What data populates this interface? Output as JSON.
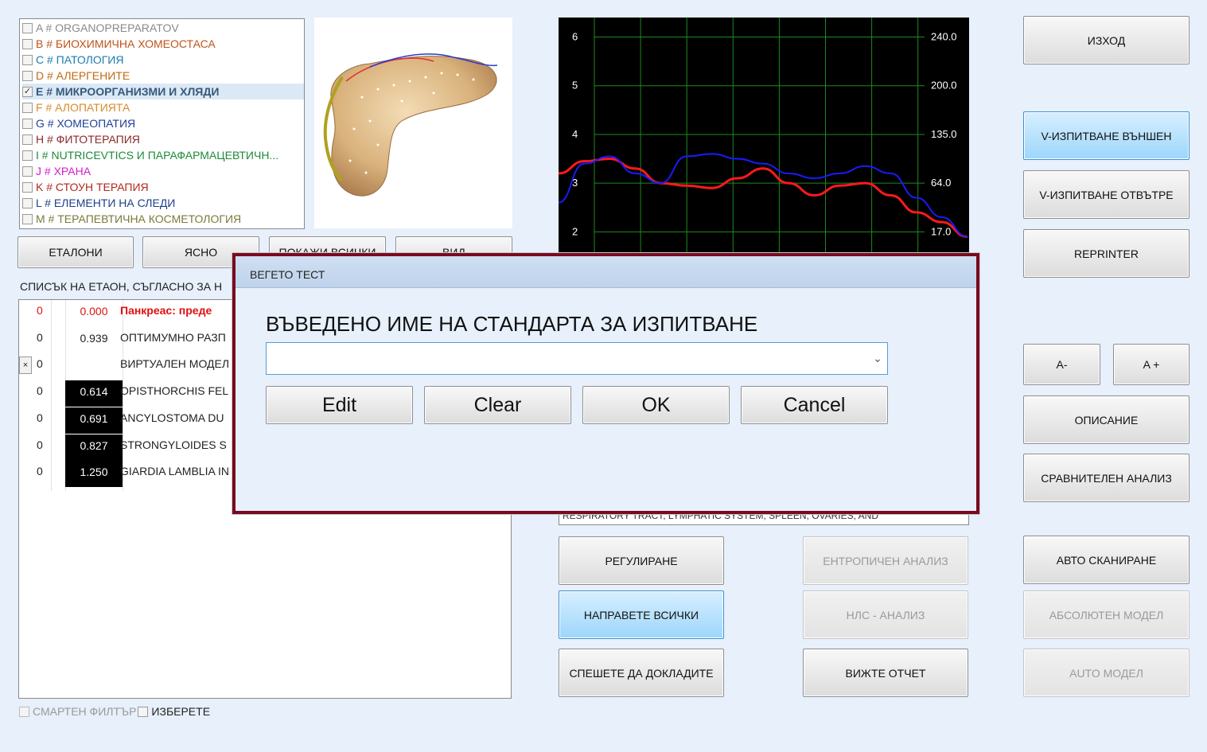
{
  "categories": [
    {
      "label": "A # ORGANOPREPARATOV",
      "color": "#8a8a8a",
      "checked": false
    },
    {
      "label": "B # БИОХИМИЧНА ХОМЕОСТАСА",
      "color": "#c0531a",
      "checked": false
    },
    {
      "label": "C # ПАТОЛОГИЯ",
      "color": "#1e7bb0",
      "checked": false
    },
    {
      "label": "D # АЛЕРГЕНИТЕ",
      "color": "#c06a12",
      "checked": false
    },
    {
      "label": "E # МИКРООРГАНИЗМИ И ХЛЯДИ",
      "color": "#355a7a",
      "checked": true
    },
    {
      "label": "F # АЛОПАТИЯТА",
      "color": "#d98a2a",
      "checked": false
    },
    {
      "label": "G # ХОМЕОПАТИЯ",
      "color": "#1f3f9a",
      "checked": false
    },
    {
      "label": "H # ФИТОТЕРАПИЯ",
      "color": "#8a2a2a",
      "checked": false
    },
    {
      "label": "I # NUTRICEVTICS И ПАРАФАРМАЦЕВТИЧН...",
      "color": "#1e8a3a",
      "checked": false
    },
    {
      "label": "J # ХРАНА",
      "color": "#d21ec9",
      "checked": false
    },
    {
      "label": "K # СТОУН ТЕРАПИЯ",
      "color": "#b02a1e",
      "checked": false
    },
    {
      "label": "L # ЕЛЕМЕНТИ НА СЛЕДИ",
      "color": "#1e3f8a",
      "checked": false
    },
    {
      "label": "M # ТЕРАПЕВТИЧНА КОСМЕТОЛОГИЯ",
      "color": "#7a7a3a",
      "checked": false
    }
  ],
  "left_buttons": {
    "etaloni": "ЕТАЛОНИ",
    "yasno": "ЯСНО",
    "show_all": "ПОКАЖИ ВСИЧКИ",
    "vid": "ВИД"
  },
  "list_heading": "СПИСЪК НА ЕТАОН, СЪГЛАСНО ЗА Н",
  "etalon_rows": [
    {
      "n": "0",
      "v": "0.000",
      "t": "Панкреас: преде",
      "dark": false,
      "red": true,
      "x": false
    },
    {
      "n": "0",
      "v": "0.939",
      "t": "ОПТИМУМНО РАЗП",
      "dark": false,
      "red": false,
      "x": false
    },
    {
      "n": "0",
      "v": "",
      "t": "ВИРТУАЛЕН МОДЕЛ",
      "dark": false,
      "red": false,
      "x": true
    },
    {
      "n": "0",
      "v": "0.614",
      "t": "OPISTHORCHIS FEL",
      "dark": true,
      "red": false,
      "x": false
    },
    {
      "n": "0",
      "v": "0.691",
      "t": "ANCYLOSTOMA DU",
      "dark": true,
      "red": false,
      "x": false
    },
    {
      "n": "0",
      "v": "0.827",
      "t": "STRONGYLOIDES  S",
      "dark": true,
      "red": false,
      "x": false
    },
    {
      "n": "0",
      "v": "1.250",
      "t": "GIARDIA LAMBLIA IN",
      "dark": true,
      "red": false,
      "x": false
    }
  ],
  "row_x_glyph": "×",
  "bottom_options": {
    "smart_filter": "СМАРТЕН ФИЛТЪР",
    "choose": "ИЗБЕРЕТЕ"
  },
  "chart_data": {
    "type": "line",
    "left_ticks": [
      "6",
      "5",
      "4",
      "3",
      "2"
    ],
    "right_ticks": [
      "240.0",
      "200.0",
      "135.0",
      "64.0",
      "17.0"
    ],
    "x": [
      0,
      1,
      2,
      3,
      4,
      5,
      6,
      7,
      8,
      9,
      10,
      11,
      12,
      13,
      14,
      15,
      16
    ],
    "ylim": [
      1.5,
      6.4
    ],
    "grid": true,
    "series": [
      {
        "color": "#ff1a1a",
        "values": [
          3.2,
          3.45,
          3.5,
          3.3,
          3.0,
          2.95,
          2.9,
          3.1,
          3.3,
          3.0,
          2.75,
          2.95,
          3.0,
          2.75,
          2.4,
          2.2,
          1.9
        ]
      },
      {
        "color": "#1a1aff",
        "values": [
          2.6,
          3.4,
          3.55,
          3.2,
          3.0,
          3.55,
          3.6,
          3.5,
          3.4,
          3.2,
          3.1,
          3.2,
          3.35,
          3.2,
          2.7,
          2.3,
          1.9
        ]
      }
    ]
  },
  "right_buttons": {
    "exit": "ИЗХОД",
    "v_test_out": "V-ИЗПИТВАНЕ ВЪНШЕН",
    "v_test_in": "V-ИЗПИТВАНЕ ОТВЪТРЕ",
    "reprinter": "REPRINTER",
    "a_minus": "A-",
    "a_plus": "A +",
    "description": "ОПИСАНИЕ",
    "comparative": "СРАВНИТЕЛЕН АНАЛИЗ",
    "auto_scan": "АВТО СКАНИРАНЕ",
    "absolute_model": "АБСОЛЮТЕН МОДЕЛ",
    "auto_model": "AUTO МОДЕЛ"
  },
  "middle_buttons": {
    "regulate": "РЕГУЛИРАНЕ",
    "do_all": "НАПРАВЕТЕ ВСИЧКИ",
    "hurry_report": "СПЕШЕТЕ ДА ДОКЛАДИТЕ",
    "entropy": "ЕНТРОПИЧЕН АНАЛИЗ",
    "nls": "НЛС - АНАЛИЗ",
    "see_report": "ВИЖТЕ ОТЧЕТ"
  },
  "resp_strip_text": "RESPIRATORY TRACT, LYMPHATIC SYSTEM, SPLEEN, OVARIES, AND",
  "dialog": {
    "title": "ВЕГЕТО ТЕСТ",
    "prompt": "ВЪВЕДЕНО ИМЕ НА СТАНДАРТА ЗА ИЗПИТВАНЕ",
    "input_value": "",
    "caret": "⌄",
    "buttons": {
      "edit": "Edit",
      "clear": "Clear",
      "ok": "OK",
      "cancel": "Cancel"
    }
  },
  "colors": {
    "accent_blue": "#9dd6fb",
    "dialog_border": "#7a0a1e",
    "chart_bg": "#000000",
    "grid": "#1f8a1f"
  }
}
